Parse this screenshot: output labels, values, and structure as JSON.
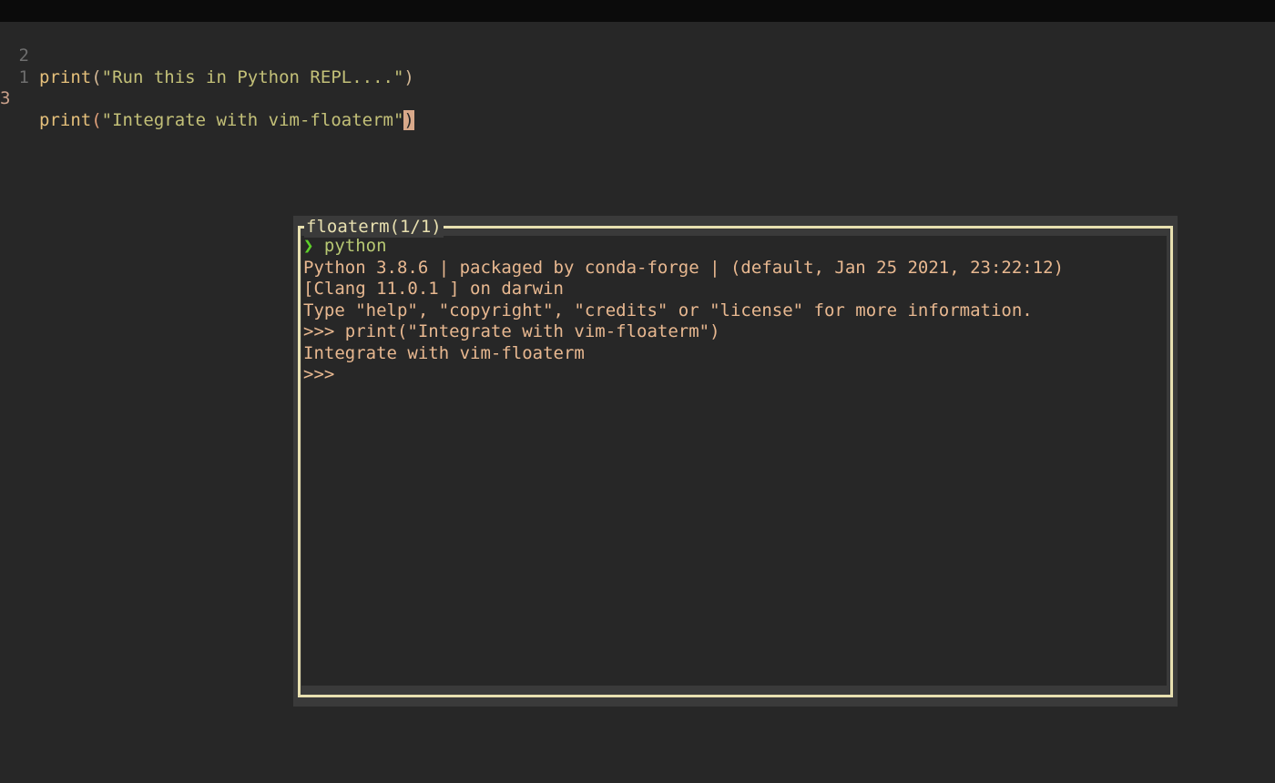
{
  "editor": {
    "lines": [
      {
        "number": "2",
        "fn": "print",
        "open": "(",
        "string": "\"Run this in Python REPL....\"",
        "close": ")"
      },
      {
        "number": "1"
      },
      {
        "number": "3",
        "fn": "print",
        "open": "(",
        "string": "\"Integrate with vim-floaterm\"",
        "close": ")"
      }
    ]
  },
  "floaterm": {
    "title": "floaterm(1/1)",
    "prompt_symbol": "❯",
    "prompt_command": "python",
    "output": [
      "Python 3.8.6 | packaged by conda-forge | (default, Jan 25 2021, 23:22:12)",
      "[Clang 11.0.1 ] on darwin",
      "Type \"help\", \"copyright\", \"credits\" or \"license\" for more information.",
      ">>> print(\"Integrate with vim-floaterm\")",
      "Integrate with vim-floaterm",
      ">>>"
    ]
  },
  "colors": {
    "background": "#272727",
    "function": "#e5c07b",
    "string": "#c3c078",
    "terminal_text": "#e8b890",
    "terminal_border": "#e8e0b0",
    "prompt_arrow": "#5ed02a"
  }
}
